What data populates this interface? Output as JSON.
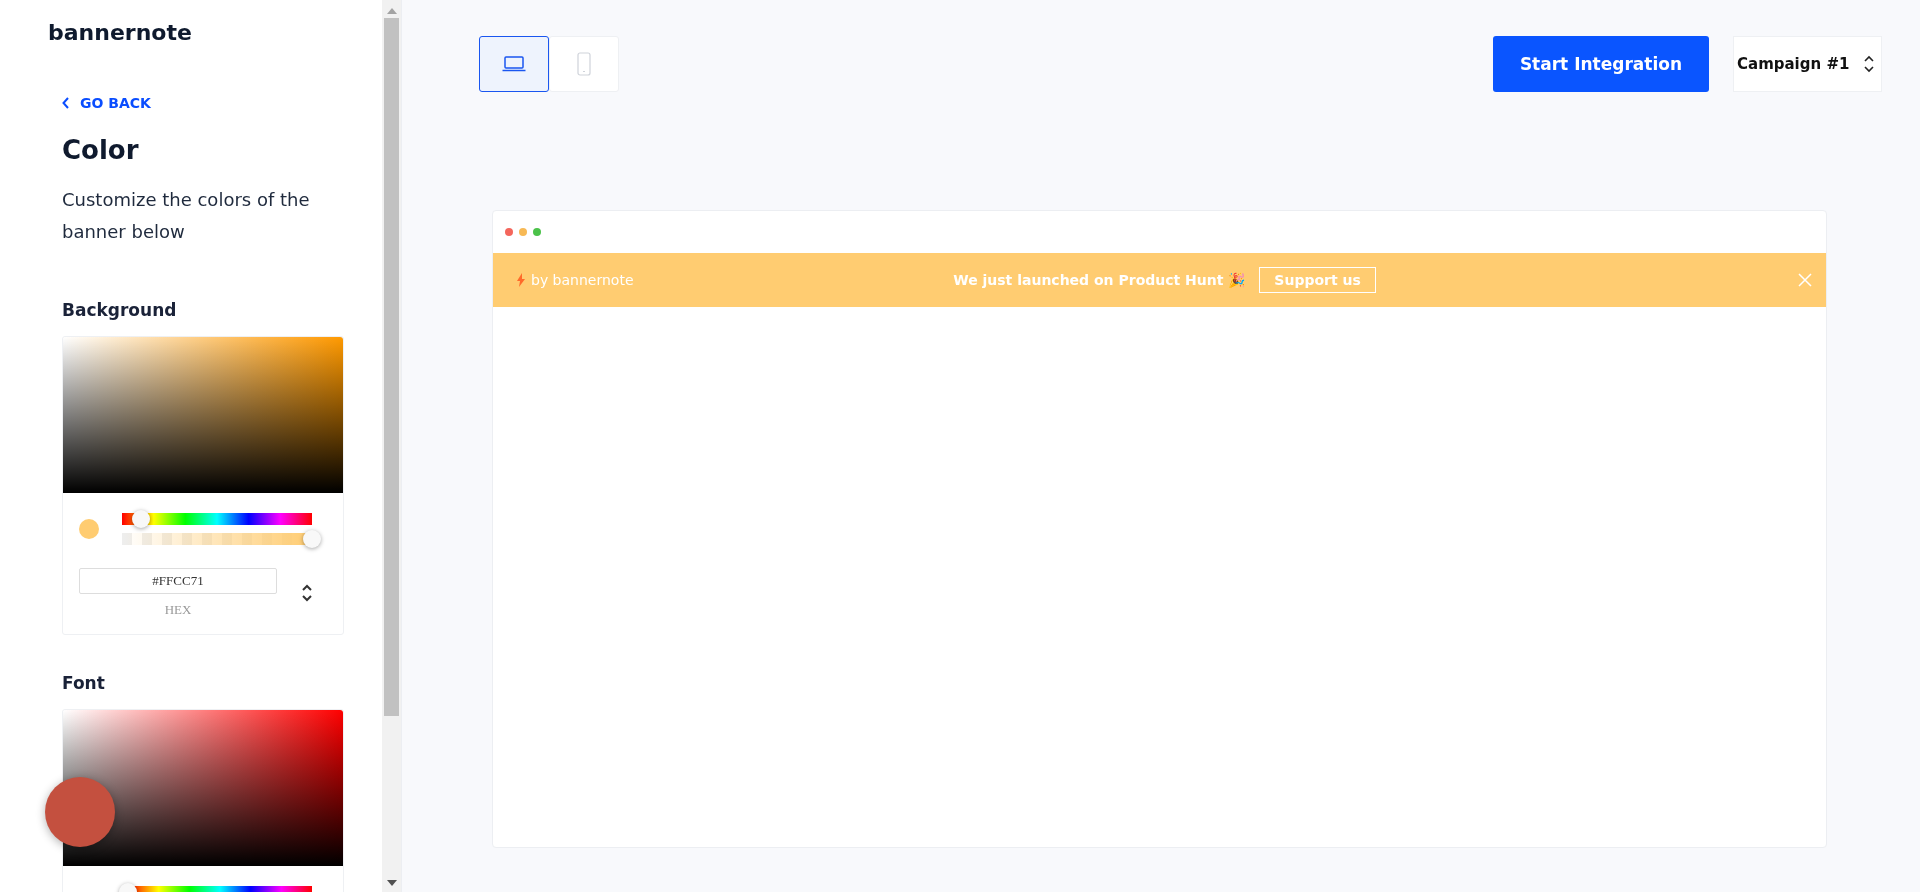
{
  "sidebar": {
    "logo": "bannernote",
    "back_link": "GO BACK",
    "title": "Color",
    "description": "Customize the colors of the banner below",
    "pickers": [
      {
        "label": "Background",
        "hue_slider": {
          "level": 0.1
        },
        "opacity_slider": {
          "level": 1
        },
        "hex_value": "#FFCC71",
        "format_label": "HEX"
      },
      {
        "label": "Font",
        "hue_slider": {
          "level": 0.0
        }
      }
    ]
  },
  "toolbar": {
    "devices": [
      {
        "kind": "desktop",
        "selected": true
      },
      {
        "kind": "mobile",
        "selected": false
      }
    ],
    "primary_button": "Start Integration",
    "campaign": "Campaign #1"
  },
  "preview": {
    "banner": {
      "brand": "by bannernote",
      "message": "We just launched on Product Hunt 🎉",
      "button": "Support us",
      "color": "#ffcc71"
    }
  }
}
